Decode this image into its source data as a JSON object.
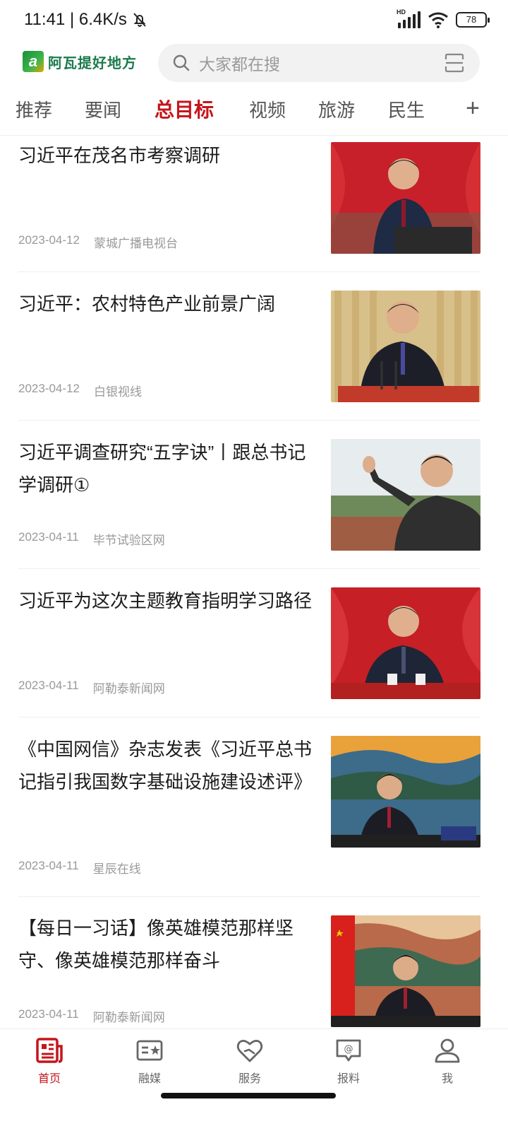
{
  "status_bar": {
    "time_speed": "11:41 | 6.4K/s",
    "battery": "78",
    "icons": [
      "bell-off-icon",
      "hd-signal-icon",
      "wifi-icon",
      "battery-icon"
    ]
  },
  "header": {
    "logo_mark": "a",
    "logo_text": "阿瓦提好地方",
    "search_placeholder": "大家都在搜"
  },
  "tabs": {
    "items": [
      {
        "label": "推荐",
        "active": false
      },
      {
        "label": "要闻",
        "active": false
      },
      {
        "label": "总目标",
        "active": true
      },
      {
        "label": "视频",
        "active": false
      },
      {
        "label": "旅游",
        "active": false
      },
      {
        "label": "民生",
        "active": false
      }
    ],
    "add_label": "+"
  },
  "articles": [
    {
      "title": "习近平在茂名市考察调研",
      "date": "2023-04-12",
      "source": "蒙城广播电视台"
    },
    {
      "title": "习近平：农村特色产业前景广阔",
      "date": "2023-04-12",
      "source": "白银视线"
    },
    {
      "title": "习近平调查研究“五字诀”丨跟总书记学调研①",
      "date": "2023-04-11",
      "source": "毕节试验区网"
    },
    {
      "title": "习近平为这次主题教育指明学习路径",
      "date": "2023-04-11",
      "source": "阿勒泰新闻网"
    },
    {
      "title": "《中国网信》杂志发表《习近平总书记指引我国数字基础设施建设述评》",
      "date": "2023-04-11",
      "source": "星辰在线"
    },
    {
      "title": "【每日一习话】像英雄模范那样坚守、像英雄模范那样奋斗",
      "date": "2023-04-11",
      "source": "阿勒泰新闻网"
    }
  ],
  "bottom_nav": {
    "items": [
      {
        "label": "首页",
        "icon": "newspaper-icon",
        "active": true
      },
      {
        "label": "融媒",
        "icon": "media-icon",
        "active": false
      },
      {
        "label": "服务",
        "icon": "heart-service-icon",
        "active": false
      },
      {
        "label": "报料",
        "icon": "report-icon",
        "active": false
      },
      {
        "label": "我",
        "icon": "user-icon",
        "active": false
      }
    ]
  },
  "colors": {
    "accent": "#c4161c",
    "text": "#1c1c1c",
    "meta": "#999999",
    "search_bg": "#f2f2f2"
  }
}
